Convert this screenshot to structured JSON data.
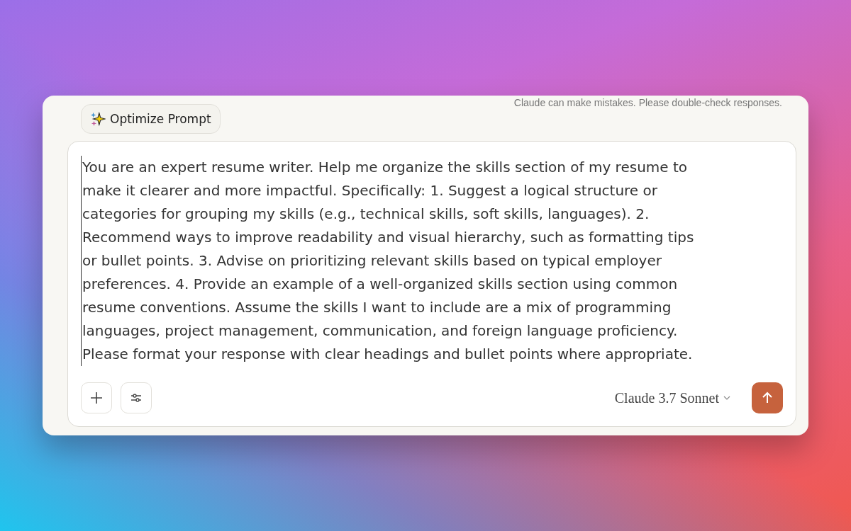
{
  "disclaimer": "Claude can make mistakes. Please double-check responses.",
  "optimize_button": {
    "label": "Optimize Prompt"
  },
  "prompt": {
    "value": "You are an expert resume writer. Help me organize the skills section of my resume to make it clearer and more impactful. Specifically:  1. Suggest a logical structure or categories for grouping my skills (e.g., technical skills, soft skills, languages). 2. Recommend ways to improve readability and visual hierarchy, such as formatting tips or bullet points. 3. Advise on prioritizing relevant skills based on typical employer preferences. 4. Provide an example of a well-organized skills section using common resume conventions.  Assume the skills I want to include are a mix of programming languages, project management, communication, and foreign language proficiency. Please format your response with clear headings and bullet points where appropriate."
  },
  "model_selector": {
    "label": "Claude 3.7 Sonnet"
  }
}
